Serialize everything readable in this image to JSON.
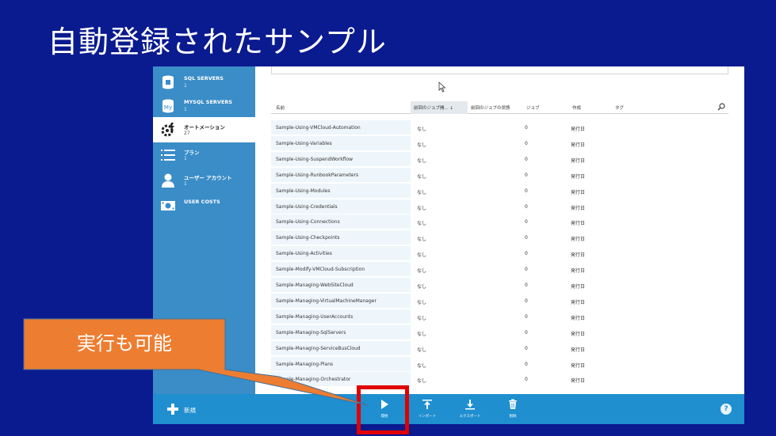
{
  "slide": {
    "title": "自動登録されたサンプル"
  },
  "callout": {
    "text": "実行も可能"
  },
  "sidebar": {
    "items": [
      {
        "label": "SQL SERVERS",
        "count": "1"
      },
      {
        "label": "MYSQL SERVERS",
        "count": "1"
      },
      {
        "label": "オートメーション",
        "count": "27"
      },
      {
        "label": "プラン",
        "count": "1"
      },
      {
        "label": "ユーザー アカウント",
        "count": "1"
      },
      {
        "label": "USER COSTS",
        "count": ""
      }
    ]
  },
  "table": {
    "columns": [
      "名前",
      "前回のジョブ開... ↓",
      "前回のジョブの状態",
      "ジョブ",
      "作成",
      "タグ"
    ],
    "rows": [
      {
        "name": "Sample-Using-VMCloud-Automation",
        "status": "なし",
        "jobs": "0",
        "author": "発行日"
      },
      {
        "name": "Sample-Using-Variables",
        "status": "なし",
        "jobs": "0",
        "author": "発行日"
      },
      {
        "name": "Sample-Using-SuspendWorkflow",
        "status": "なし",
        "jobs": "0",
        "author": "発行日"
      },
      {
        "name": "Sample-Using-RunbookParameters",
        "status": "なし",
        "jobs": "0",
        "author": "発行日"
      },
      {
        "name": "Sample-Using-Modules",
        "status": "なし",
        "jobs": "0",
        "author": "発行日"
      },
      {
        "name": "Sample-Using-Credentials",
        "status": "なし",
        "jobs": "0",
        "author": "発行日"
      },
      {
        "name": "Sample-Using-Connections",
        "status": "なし",
        "jobs": "0",
        "author": "発行日"
      },
      {
        "name": "Sample-Using-Checkpoints",
        "status": "なし",
        "jobs": "0",
        "author": "発行日"
      },
      {
        "name": "Sample-Using-Activities",
        "status": "なし",
        "jobs": "0",
        "author": "発行日"
      },
      {
        "name": "Sample-Modify-VMCloud-Subscription",
        "status": "なし",
        "jobs": "0",
        "author": "発行日"
      },
      {
        "name": "Sample-Managing-WebSiteCloud",
        "status": "なし",
        "jobs": "0",
        "author": "発行日"
      },
      {
        "name": "Sample-Managing-VirtualMachineManager",
        "status": "なし",
        "jobs": "0",
        "author": "発行日"
      },
      {
        "name": "Sample-Managing-UserAccounts",
        "status": "なし",
        "jobs": "0",
        "author": "発行日"
      },
      {
        "name": "Sample-Managing-SqlServers",
        "status": "なし",
        "jobs": "0",
        "author": "発行日"
      },
      {
        "name": "Sample-Managing-ServiceBusCloud",
        "status": "なし",
        "jobs": "0",
        "author": "発行日"
      },
      {
        "name": "Sample-Managing-Plans",
        "status": "なし",
        "jobs": "0",
        "author": "発行日"
      },
      {
        "name": "Sample-Managing-Orchestrator",
        "status": "なし",
        "jobs": "0",
        "author": "発行日"
      }
    ]
  },
  "bottom_bar": {
    "new_label": "新規",
    "commands": [
      {
        "label": "開始",
        "icon": "play-icon"
      },
      {
        "label": "インポート",
        "icon": "upload-icon"
      },
      {
        "label": "エクスポート",
        "icon": "download-icon"
      },
      {
        "label": "削除",
        "icon": "trash-icon"
      }
    ],
    "help": "?"
  },
  "colors": {
    "slide_bg": "#0a1a8f",
    "sidebar": "#3a8dc7",
    "command_bar": "#1f8fcf",
    "callout": "#ed7d31",
    "highlight": "#e00000"
  }
}
